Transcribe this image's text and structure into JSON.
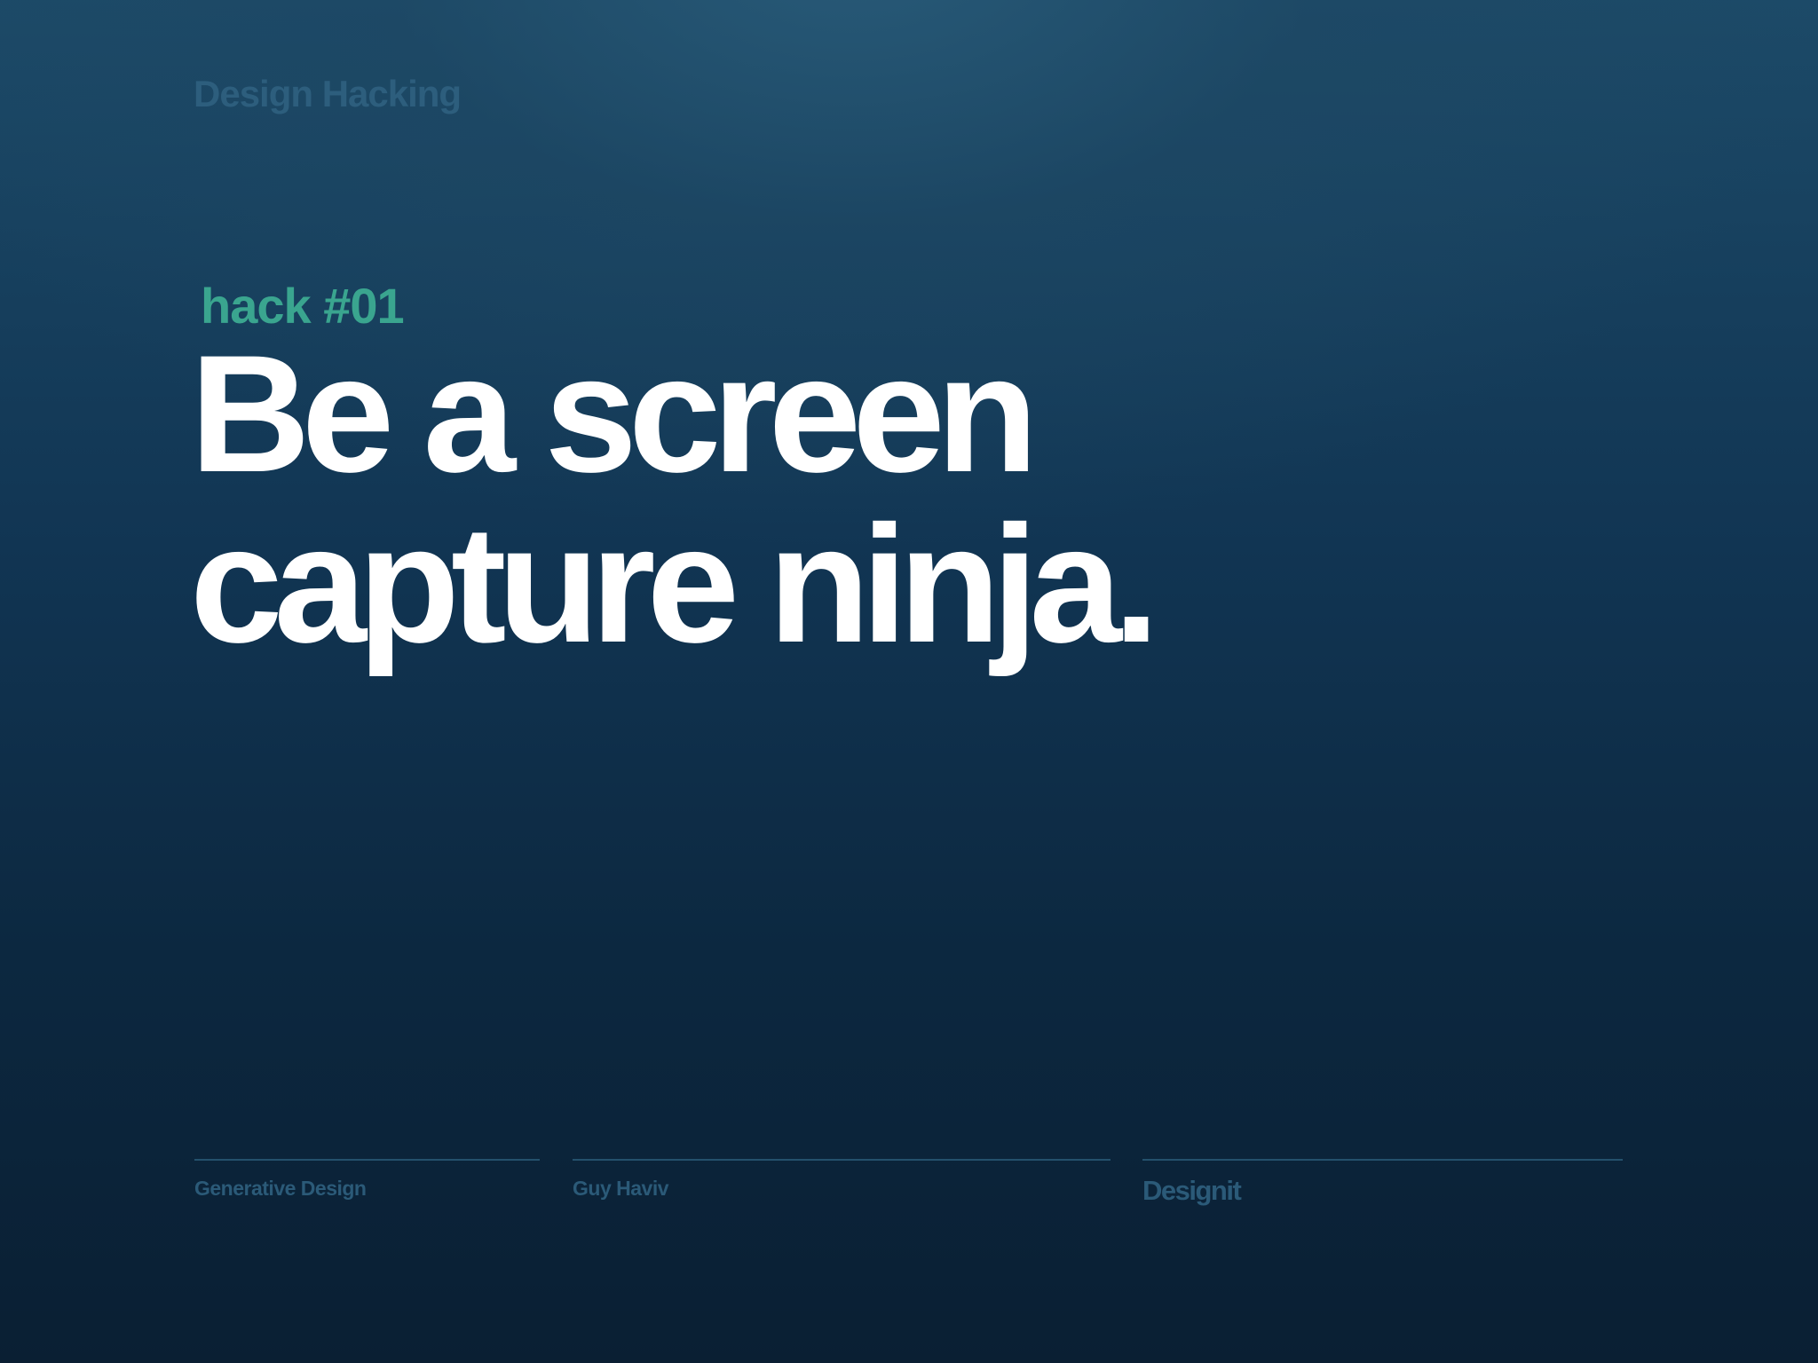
{
  "header": {
    "brand": "Design Hacking"
  },
  "hero": {
    "kicker": "hack #01",
    "title_lines": [
      "Be a screen",
      "capture ninja."
    ]
  },
  "footer": {
    "topic": "Generative Design",
    "author": "Guy Haviv",
    "company": "Designit"
  },
  "colors": {
    "accent": "#3aa58f",
    "title": "#ffffff",
    "muted": "#2b5a78",
    "background_top": "#285a78",
    "background_bottom": "#0a1f33"
  }
}
